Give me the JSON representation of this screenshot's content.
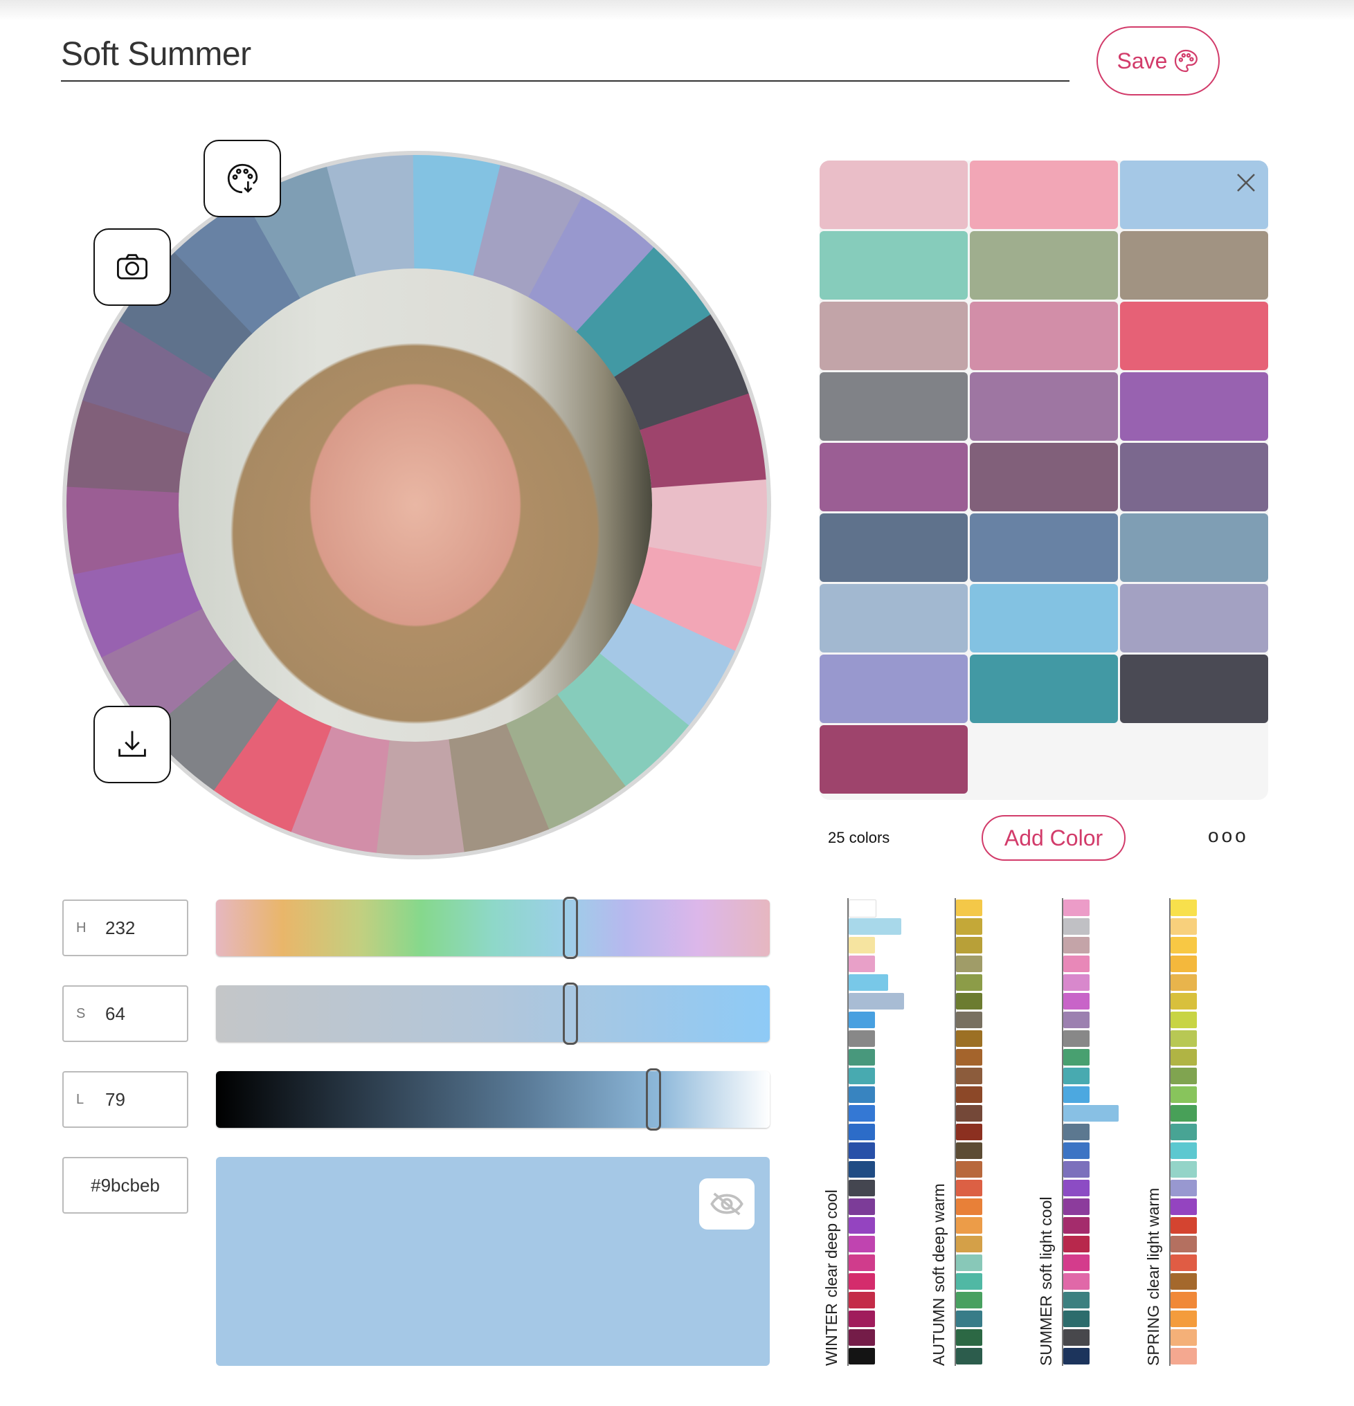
{
  "palette_name": "Soft Summer",
  "save_label": "Save",
  "color_count": "25 colors",
  "add_color_label": "Add Color",
  "more_label": "ooo",
  "hsl": {
    "h_label": "H",
    "h": "232",
    "s_label": "S",
    "s": "64",
    "l_label": "L",
    "l": "79",
    "hex": "#9bcbeb"
  },
  "slider_positions": {
    "hue": 0.64,
    "saturation": 0.64,
    "lightness": 0.79
  },
  "preview_color": "#a5c8e6",
  "accent_color": "#d23b6a",
  "palette_colors": [
    "#eabec8",
    "#f2a6b6",
    "#a5c8e6",
    "#86ccbb",
    "#9fae8e",
    "#a19382",
    "#c2a4a8",
    "#d28ea8",
    "#e66176",
    "#808287",
    "#9e76a2",
    "#9862b0",
    "#9b5e94",
    "#81607a",
    "#7b688e",
    "#5f728c",
    "#6882a4",
    "#7f9eb4",
    "#a2b8d0",
    "#83c2e2",
    "#a3a1c2",
    "#9898ce",
    "#4299a4",
    "#4a4a54",
    "#9e446c"
  ],
  "wheel_colors": [
    "#a2b8d0",
    "#83c2e2",
    "#a3a1c2",
    "#9898ce",
    "#4299a4",
    "#4a4a54",
    "#9e446c",
    "#eabec8",
    "#f2a6b6",
    "#a5c8e6",
    "#86ccbb",
    "#9fae8e",
    "#a19382",
    "#c2a4a8",
    "#d28ea8",
    "#e66176",
    "#808287",
    "#9e76a2",
    "#9862b0",
    "#9b5e94",
    "#81607a",
    "#7b688e",
    "#5f728c",
    "#6882a4",
    "#7f9eb4"
  ],
  "icons": {
    "wheel_palette": "palette-download-icon",
    "camera": "camera-icon",
    "download": "download-icon",
    "close": "close-icon",
    "eye_off": "eye-off-icon"
  },
  "seasons": [
    {
      "name": "WINTER",
      "desc": "clear deep cool",
      "bars": [
        {
          "c": "#ffffff",
          "w": 1
        },
        {
          "c": "#a8d8ea",
          "w": 2
        },
        {
          "c": "#f6e4a0",
          "w": 1
        },
        {
          "c": "#e8a0c8",
          "w": 1
        },
        {
          "c": "#78c8e8",
          "w": 1.5
        },
        {
          "c": "#a8bcd4",
          "w": 2.1
        },
        {
          "c": "#48a0e0",
          "w": 1
        },
        {
          "c": "#888888",
          "w": 1
        },
        {
          "c": "#48987c",
          "w": 1
        },
        {
          "c": "#48aab0",
          "w": 1
        },
        {
          "c": "#3884c0",
          "w": 1
        },
        {
          "c": "#3478d4",
          "w": 1
        },
        {
          "c": "#2c6cc8",
          "w": 1
        },
        {
          "c": "#2850a8",
          "w": 1
        },
        {
          "c": "#204c84",
          "w": 1
        },
        {
          "c": "#444650",
          "w": 1
        },
        {
          "c": "#7c3c98",
          "w": 1
        },
        {
          "c": "#9444c0",
          "w": 1
        },
        {
          "c": "#c044b0",
          "w": 1
        },
        {
          "c": "#d03c8c",
          "w": 1
        },
        {
          "c": "#d42c6c",
          "w": 1
        },
        {
          "c": "#c42c48",
          "w": 1
        },
        {
          "c": "#a01c5c",
          "w": 1
        },
        {
          "c": "#741c48",
          "w": 1
        },
        {
          "c": "#141414",
          "w": 1
        }
      ]
    },
    {
      "name": "AUTUMN",
      "desc": "soft deep warm",
      "bars": [
        {
          "c": "#f4c848",
          "w": 1
        },
        {
          "c": "#c4a838",
          "w": 1
        },
        {
          "c": "#b8a038",
          "w": 1
        },
        {
          "c": "#a09c68",
          "w": 1
        },
        {
          "c": "#8c9c48",
          "w": 1
        },
        {
          "c": "#6c7c30",
          "w": 1
        },
        {
          "c": "#787060",
          "w": 1
        },
        {
          "c": "#9c7024",
          "w": 1
        },
        {
          "c": "#a4642c",
          "w": 1
        },
        {
          "c": "#8c5c3c",
          "w": 1
        },
        {
          "c": "#8c4828",
          "w": 1
        },
        {
          "c": "#744838",
          "w": 1
        },
        {
          "c": "#8c3020",
          "w": 1
        },
        {
          "c": "#5c4c34",
          "w": 1
        },
        {
          "c": "#b8683c",
          "w": 1
        },
        {
          "c": "#dc6044",
          "w": 1
        },
        {
          "c": "#e88038",
          "w": 1
        },
        {
          "c": "#ec9c48",
          "w": 1
        },
        {
          "c": "#d4a048",
          "w": 1
        },
        {
          "c": "#88c8b8",
          "w": 1
        },
        {
          "c": "#50b8a4",
          "w": 1
        },
        {
          "c": "#48a060",
          "w": 1
        },
        {
          "c": "#387c88",
          "w": 1
        },
        {
          "c": "#2c6844",
          "w": 1
        },
        {
          "c": "#2c5c4c",
          "w": 1
        }
      ]
    },
    {
      "name": "SUMMER",
      "desc": "soft light cool",
      "bars": [
        {
          "c": "#ec9cc8",
          "w": 1
        },
        {
          "c": "#c0c0c4",
          "w": 1
        },
        {
          "c": "#c4a4a8",
          "w": 1
        },
        {
          "c": "#e888b8",
          "w": 1
        },
        {
          "c": "#d888cc",
          "w": 1
        },
        {
          "c": "#c864c8",
          "w": 1
        },
        {
          "c": "#9c80b0",
          "w": 1
        },
        {
          "c": "#888888",
          "w": 1
        },
        {
          "c": "#48a070",
          "w": 1
        },
        {
          "c": "#48aab0",
          "w": 1
        },
        {
          "c": "#4ca8e0",
          "w": 1
        },
        {
          "c": "#88c0e4",
          "w": 2.1
        },
        {
          "c": "#5c7890",
          "w": 1
        },
        {
          "c": "#3c74c4",
          "w": 1
        },
        {
          "c": "#7c70bc",
          "w": 1
        },
        {
          "c": "#8c4cc4",
          "w": 1
        },
        {
          "c": "#8c3c9c",
          "w": 1
        },
        {
          "c": "#a42c6c",
          "w": 1
        },
        {
          "c": "#b8284c",
          "w": 1
        },
        {
          "c": "#d43c8c",
          "w": 1
        },
        {
          "c": "#e068a8",
          "w": 1
        },
        {
          "c": "#3c8080",
          "w": 1
        },
        {
          "c": "#2c6c6c",
          "w": 1
        },
        {
          "c": "#48484c",
          "w": 1
        },
        {
          "c": "#1c345c",
          "w": 1
        }
      ]
    },
    {
      "name": "SPRING",
      "desc": "clear light warm",
      "bars": [
        {
          "c": "#f8e04c",
          "w": 1
        },
        {
          "c": "#f8d07c",
          "w": 1
        },
        {
          "c": "#f8c844",
          "w": 1
        },
        {
          "c": "#f4b83c",
          "w": 1
        },
        {
          "c": "#e8b44c",
          "w": 1
        },
        {
          "c": "#d8c03c",
          "w": 1
        },
        {
          "c": "#c8d444",
          "w": 1
        },
        {
          "c": "#b8c854",
          "w": 1
        },
        {
          "c": "#b0b444",
          "w": 1
        },
        {
          "c": "#80a450",
          "w": 1
        },
        {
          "c": "#88c45c",
          "w": 1
        },
        {
          "c": "#48a058",
          "w": 1
        },
        {
          "c": "#48a494",
          "w": 1
        },
        {
          "c": "#5cc8d0",
          "w": 1
        },
        {
          "c": "#94d4c8",
          "w": 1
        },
        {
          "c": "#9898d0",
          "w": 1
        },
        {
          "c": "#9444c0",
          "w": 1
        },
        {
          "c": "#d44430",
          "w": 1
        },
        {
          "c": "#b47060",
          "w": 1
        },
        {
          "c": "#e05c44",
          "w": 1
        },
        {
          "c": "#a4682c",
          "w": 1
        },
        {
          "c": "#f08838",
          "w": 1
        },
        {
          "c": "#f49c3c",
          "w": 1
        },
        {
          "c": "#f4b078",
          "w": 1
        },
        {
          "c": "#f4a890",
          "w": 1
        }
      ]
    }
  ]
}
